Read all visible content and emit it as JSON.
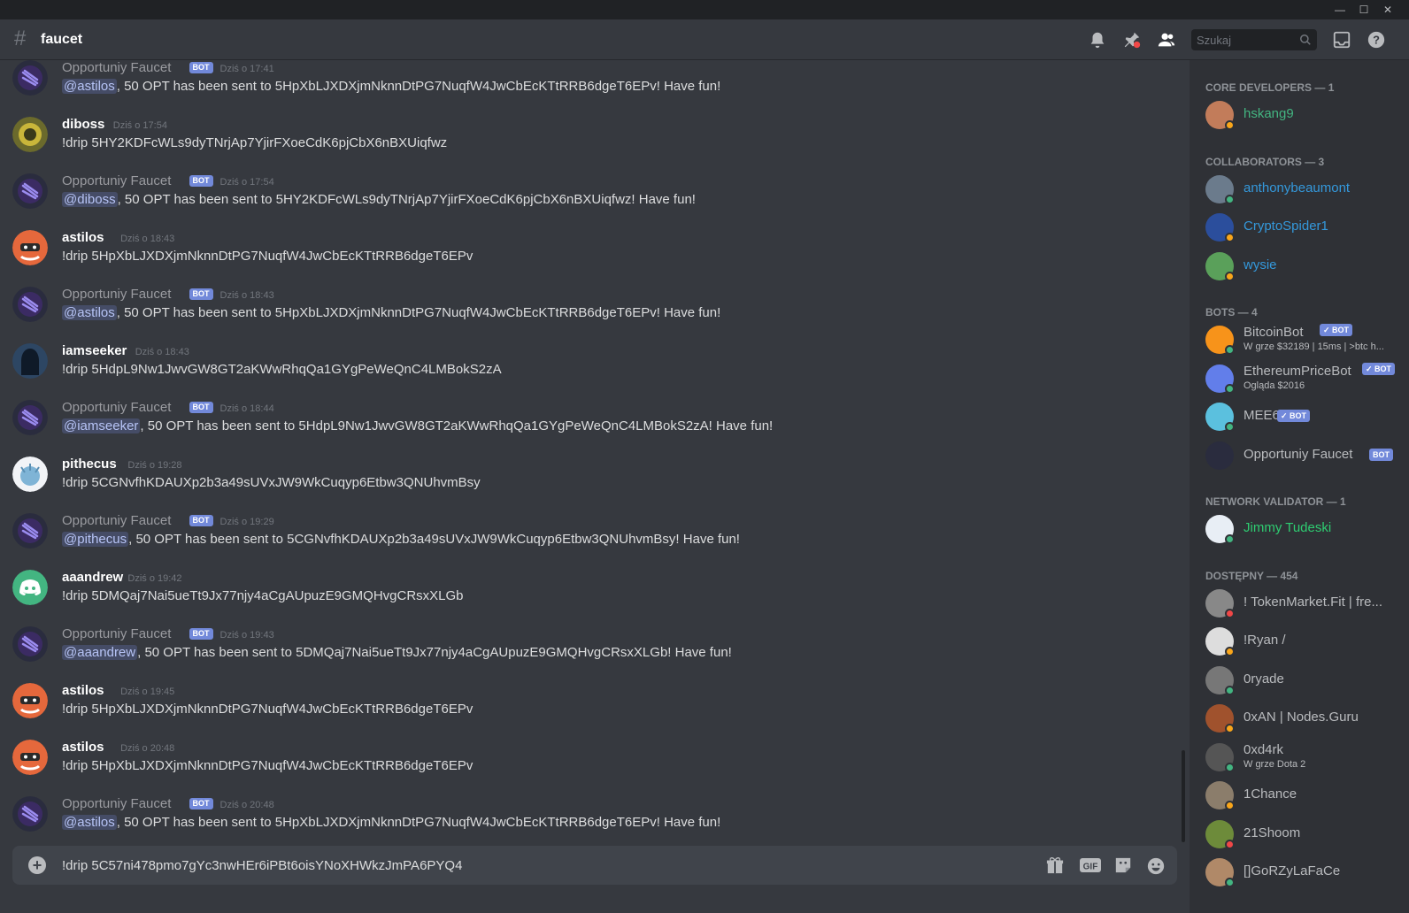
{
  "window": {
    "minimize": "—",
    "maximize": "☐",
    "close": "✕"
  },
  "header": {
    "channel_name": "faucet",
    "search_placeholder": "Szukaj"
  },
  "messages": [
    {
      "user": "Opportuniy Faucet",
      "bot": true,
      "badge": "BOT",
      "time": "Dziś o 17:41",
      "mention": "@astilos",
      "text": ", 50 OPT has been sent to 5HpXbLJXDXjmNknnDtPG7NuqfW4JwCbEcKTtRRB6dgeT6EPv! Have fun!"
    },
    {
      "user": "diboss",
      "bot": false,
      "time": "Dziś o 17:54",
      "text": "!drip 5HY2KDFcWLs9dyTNrjAp7YjirFXoeCdK6pjCbX6nBXUiqfwz"
    },
    {
      "user": "Opportuniy Faucet",
      "bot": true,
      "badge": "BOT",
      "time": "Dziś o 17:54",
      "mention": "@diboss",
      "text": ", 50 OPT has been sent to 5HY2KDFcWLs9dyTNrjAp7YjirFXoeCdK6pjCbX6nBXUiqfwz! Have fun!"
    },
    {
      "user": "astilos",
      "bot": false,
      "time": "Dziś o 18:43",
      "text": "!drip 5HpXbLJXDXjmNknnDtPG7NuqfW4JwCbEcKTtRRB6dgeT6EPv"
    },
    {
      "user": "Opportuniy Faucet",
      "bot": true,
      "badge": "BOT",
      "time": "Dziś o 18:43",
      "mention": "@astilos",
      "text": ", 50 OPT has been sent to 5HpXbLJXDXjmNknnDtPG7NuqfW4JwCbEcKTtRRB6dgeT6EPv! Have fun!"
    },
    {
      "user": "iamseeker",
      "bot": false,
      "time": "Dziś o 18:43",
      "text": "!drip 5HdpL9Nw1JwvGW8GT2aKWwRhqQa1GYgPeWeQnC4LMBokS2zA"
    },
    {
      "user": "Opportuniy Faucet",
      "bot": true,
      "badge": "BOT",
      "time": "Dziś o 18:44",
      "mention": "@iamseeker",
      "text": ", 50 OPT has been sent to 5HdpL9Nw1JwvGW8GT2aKWwRhqQa1GYgPeWeQnC4LMBokS2zA! Have fun!"
    },
    {
      "user": "pithecus",
      "bot": false,
      "time": "Dziś o 19:28",
      "text": "!drip 5CGNvfhKDAUXp2b3a49sUVxJW9WkCuqyp6Etbw3QNUhvmBsy"
    },
    {
      "user": "Opportuniy Faucet",
      "bot": true,
      "badge": "BOT",
      "time": "Dziś o 19:29",
      "mention": "@pithecus",
      "text": ", 50 OPT has been sent to 5CGNvfhKDAUXp2b3a49sUVxJW9WkCuqyp6Etbw3QNUhvmBsy! Have fun!"
    },
    {
      "user": "aaandrew",
      "bot": false,
      "time": "Dziś o 19:42",
      "text": "!drip 5DMQaj7Nai5ueTt9Jx77njy4aCgAUpuzE9GMQHvgCRsxXLGb"
    },
    {
      "user": "Opportuniy Faucet",
      "bot": true,
      "badge": "BOT",
      "time": "Dziś o 19:43",
      "mention": "@aaandrew",
      "text": ", 50 OPT has been sent to 5DMQaj7Nai5ueTt9Jx77njy4aCgAUpuzE9GMQHvgCRsxXLGb! Have fun!"
    },
    {
      "user": "astilos",
      "bot": false,
      "time": "Dziś o 19:45",
      "text": "!drip 5HpXbLJXDXjmNknnDtPG7NuqfW4JwCbEcKTtRRB6dgeT6EPv"
    },
    {
      "user": "astilos",
      "bot": false,
      "time": "Dziś o 20:48",
      "text": "!drip 5HpXbLJXDXjmNknnDtPG7NuqfW4JwCbEcKTtRRB6dgeT6EPv"
    },
    {
      "user": "Opportuniy Faucet",
      "bot": true,
      "badge": "BOT",
      "time": "Dziś o 20:48",
      "mention": "@astilos",
      "text": ", 50 OPT has been sent to 5HpXbLJXDXjmNknnDtPG7NuqfW4JwCbEcKTtRRB6dgeT6EPv! Have fun!"
    }
  ],
  "composer": {
    "value": "!drip 5C57ni478pmo7gYc3nwHEr6iPBt6oisYNoXHWkzJmPA6PYQ4"
  },
  "members": {
    "groups": [
      {
        "title": "CORE DEVELOPERS — 1",
        "members": [
          {
            "name": "hskang9",
            "color": "#43b581",
            "status": "#faa61a"
          }
        ]
      },
      {
        "title": "COLLABORATORS — 3",
        "members": [
          {
            "name": "anthonybeaumont",
            "color": "#3498db",
            "status": "#43b581"
          },
          {
            "name": "CryptoSpider1",
            "color": "#3498db",
            "status": "#faa61a"
          },
          {
            "name": "wysie",
            "color": "#3498db",
            "status": "#faa61a"
          }
        ]
      },
      {
        "title": "BOTS — 4",
        "members": [
          {
            "name": "BitcoinBot",
            "color": "#b9bbbe",
            "status": "#43b581",
            "badge": "✓ BOT",
            "sub": "W grze $32189 | 15ms | >btc h..."
          },
          {
            "name": "EthereumPriceBot",
            "color": "#b9bbbe",
            "status": "#43b581",
            "badge": "✓ BOT",
            "sub": "Ogląda $2016"
          },
          {
            "name": "MEE6",
            "color": "#b9bbbe",
            "status": "#43b581",
            "badge": "✓ BOT"
          },
          {
            "name": "Opportuniy Faucet",
            "color": "#b9bbbe",
            "badge": "BOT"
          }
        ]
      },
      {
        "title": "NETWORK VALIDATOR — 1",
        "members": [
          {
            "name": "Jimmy Tudeski",
            "color": "#2ecc71",
            "status": "#43b581"
          }
        ]
      },
      {
        "title": "DOSTĘPNY — 454",
        "members": [
          {
            "name": "! TokenMarket.Fit | fre...",
            "color": "#b9bbbe",
            "status": "#f04747"
          },
          {
            "name": "!Ryan /",
            "color": "#b9bbbe",
            "status": "#faa61a"
          },
          {
            "name": "0ryade",
            "color": "#b9bbbe",
            "status": "#43b581"
          },
          {
            "name": "0xAN | Nodes.Guru",
            "color": "#b9bbbe",
            "status": "#faa61a"
          },
          {
            "name": "0xd4rk",
            "color": "#b9bbbe",
            "status": "#43b581",
            "sub": "W grze Dota 2"
          },
          {
            "name": "1Chance",
            "color": "#b9bbbe",
            "status": "#faa61a"
          },
          {
            "name": "21Shoom",
            "color": "#b9bbbe",
            "status": "#f04747"
          },
          {
            "name": "[]GoRZyLaFaCe",
            "color": "#b9bbbe",
            "status": "#43b581"
          }
        ]
      }
    ]
  }
}
